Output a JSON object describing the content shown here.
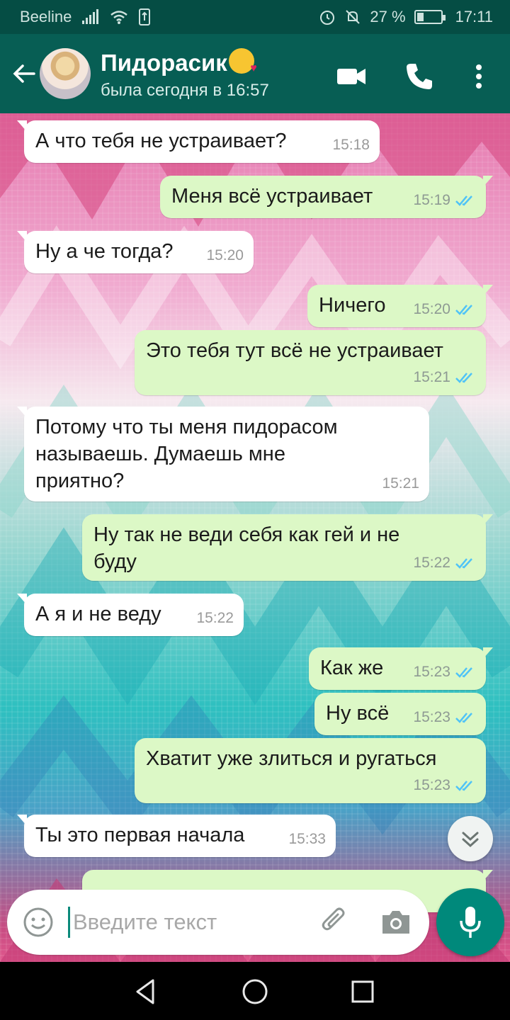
{
  "status_bar": {
    "carrier": "Beeline",
    "battery": "27 %",
    "battery_level": 0.27,
    "time": "17:11"
  },
  "header": {
    "contact_name": "Пидорасик",
    "contact_emoji": "face-blowing-kiss",
    "status": "была сегодня в 16:57",
    "icons": [
      "back-arrow-icon",
      "video-call-icon",
      "phone-icon",
      "more-vert-icon"
    ]
  },
  "messages": [
    {
      "dir": "in",
      "text": "А что тебя не устраивает?",
      "time": "15:18"
    },
    {
      "dir": "out",
      "text": "Меня всё устраивает",
      "time": "15:19",
      "read": true
    },
    {
      "dir": "in",
      "text": "Ну а че тогда?",
      "time": "15:20"
    },
    {
      "dir": "out",
      "text": "Ничего",
      "time": "15:20",
      "read": true
    },
    {
      "dir": "out",
      "text": "Это тебя тут всё не устраивает",
      "time": "15:21",
      "read": true
    },
    {
      "dir": "in",
      "lines": [
        "Потому что ты меня пидорасом",
        "называешь. Думаешь мне",
        "приятно?"
      ],
      "time": "15:21"
    },
    {
      "dir": "out",
      "lines": [
        "Ну так не веди себя как гей и не",
        "буду"
      ],
      "time": "15:22",
      "read": true
    },
    {
      "dir": "in",
      "text": "А я и не веду",
      "time": "15:22"
    },
    {
      "dir": "out",
      "text": "Как же",
      "time": "15:23",
      "read": true
    },
    {
      "dir": "out",
      "text": "Ну всё",
      "time": "15:23",
      "read": true
    },
    {
      "dir": "out",
      "text": "Хватит уже злиться и ругаться",
      "time": "15:23",
      "read": true
    },
    {
      "dir": "in",
      "text": "Ты это первая начала",
      "time": "15:33"
    }
  ],
  "input": {
    "placeholder": "Введите текст",
    "icons": [
      "emoji-icon",
      "attach-icon",
      "camera-icon",
      "mic-icon"
    ]
  },
  "colors": {
    "header": "#075e54",
    "status_bar": "#054d44",
    "outgoing_bubble": "#dcf8c6",
    "incoming_bubble": "#ffffff",
    "read_ticks": "#4fc3f7",
    "mic_button": "#00897b"
  }
}
